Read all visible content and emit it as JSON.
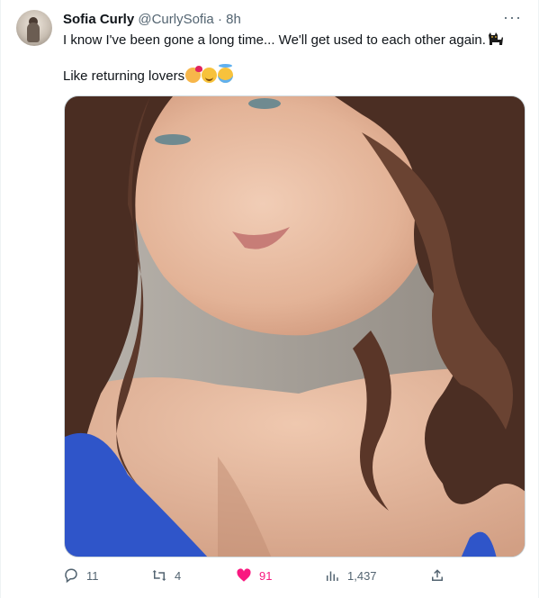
{
  "tweet": {
    "author_name": "Sofia Curly",
    "author_handle": "@CurlySofia",
    "separator": "·",
    "time": "8h",
    "more_label": "···",
    "line1": "I know I've been gone a long time... We'll get used to each other again.",
    "line2": "Like returning lovers",
    "emojis": [
      "smiling-face-with-hearts",
      "smiling-face-with-smiling-eyes",
      "smiling-face-with-halo",
      "black-cat"
    ],
    "image": {
      "icon": "photo",
      "description_colors": {
        "hair": "#4a2d22",
        "skin": "#e9bfa6",
        "garment": "#2f55c9"
      }
    }
  },
  "actions": {
    "replies": "11",
    "reposts": "4",
    "likes": "91",
    "views": "1,437"
  },
  "colors": {
    "text": "#0f1419",
    "secondary": "#536471",
    "like": "#f91880",
    "border": "#cfd9de"
  }
}
